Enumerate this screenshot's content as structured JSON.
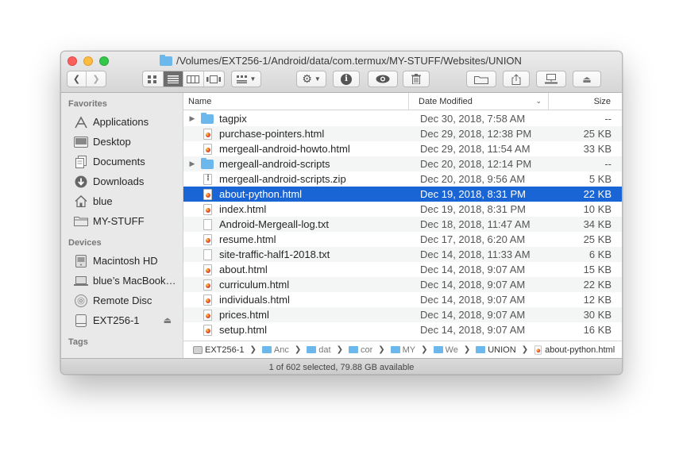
{
  "window": {
    "title": "/Volumes/EXT256-1/Android/data/com.termux/MY-STUFF/Websites/UNION"
  },
  "sidebar": {
    "sections": [
      {
        "label": "Favorites",
        "items": [
          {
            "label": "Applications",
            "icon": "applications-icon"
          },
          {
            "label": "Desktop",
            "icon": "desktop-icon"
          },
          {
            "label": "Documents",
            "icon": "documents-icon"
          },
          {
            "label": "Downloads",
            "icon": "downloads-icon"
          },
          {
            "label": "blue",
            "icon": "home-icon"
          },
          {
            "label": "MY-STUFF",
            "icon": "folder-icon"
          }
        ]
      },
      {
        "label": "Devices",
        "items": [
          {
            "label": "Macintosh HD",
            "icon": "hard-drive-icon"
          },
          {
            "label": "blue’s MacBook…",
            "icon": "laptop-icon"
          },
          {
            "label": "Remote Disc",
            "icon": "disc-icon"
          },
          {
            "label": "EXT256-1",
            "icon": "external-drive-icon",
            "eject": "⏏"
          }
        ]
      },
      {
        "label": "Tags",
        "items": []
      }
    ]
  },
  "columns": {
    "name": "Name",
    "date": "Date Modified",
    "size": "Size"
  },
  "files": [
    {
      "name": "tagpix",
      "date": "Dec 30, 2018, 7:58 AM",
      "size": "--",
      "kind": "folder"
    },
    {
      "name": "purchase-pointers.html",
      "date": "Dec 29, 2018, 12:38 PM",
      "size": "25 KB",
      "kind": "html"
    },
    {
      "name": "mergeall-android-howto.html",
      "date": "Dec 29, 2018, 11:54 AM",
      "size": "33 KB",
      "kind": "html"
    },
    {
      "name": "mergeall-android-scripts",
      "date": "Dec 20, 2018, 12:14 PM",
      "size": "--",
      "kind": "folder"
    },
    {
      "name": "mergeall-android-scripts.zip",
      "date": "Dec 20, 2018, 9:56 AM",
      "size": "5 KB",
      "kind": "zip"
    },
    {
      "name": "about-python.html",
      "date": "Dec 19, 2018, 8:31 PM",
      "size": "22 KB",
      "kind": "html",
      "selected": true
    },
    {
      "name": "index.html",
      "date": "Dec 19, 2018, 8:31 PM",
      "size": "10 KB",
      "kind": "html"
    },
    {
      "name": "Android-Mergeall-log.txt",
      "date": "Dec 18, 2018, 11:47 AM",
      "size": "34 KB",
      "kind": "txt"
    },
    {
      "name": "resume.html",
      "date": "Dec 17, 2018, 6:20 AM",
      "size": "25 KB",
      "kind": "html"
    },
    {
      "name": "site-traffic-half1-2018.txt",
      "date": "Dec 14, 2018, 11:33 AM",
      "size": "6 KB",
      "kind": "txt"
    },
    {
      "name": "about.html",
      "date": "Dec 14, 2018, 9:07 AM",
      "size": "15 KB",
      "kind": "html"
    },
    {
      "name": "curriculum.html",
      "date": "Dec 14, 2018, 9:07 AM",
      "size": "22 KB",
      "kind": "html"
    },
    {
      "name": "individuals.html",
      "date": "Dec 14, 2018, 9:07 AM",
      "size": "12 KB",
      "kind": "html"
    },
    {
      "name": "prices.html",
      "date": "Dec 14, 2018, 9:07 AM",
      "size": "30 KB",
      "kind": "html"
    },
    {
      "name": "setup.html",
      "date": "Dec 14, 2018, 9:07 AM",
      "size": "16 KB",
      "kind": "html"
    }
  ],
  "pathbar": [
    {
      "label": "EXT256-1",
      "kind": "drive"
    },
    {
      "label": "Anc",
      "kind": "folder",
      "truncated": true
    },
    {
      "label": "dat",
      "kind": "folder",
      "truncated": true
    },
    {
      "label": "cor",
      "kind": "folder",
      "truncated": true
    },
    {
      "label": "MY",
      "kind": "folder",
      "truncated": true
    },
    {
      "label": "We",
      "kind": "folder",
      "truncated": true
    },
    {
      "label": "UNION",
      "kind": "folder"
    },
    {
      "label": "about-python.html",
      "kind": "html"
    }
  ],
  "status": "1 of 602 selected, 79.88 GB available",
  "colors": {
    "selection": "#1a65d6",
    "folder": "#6cb8ec"
  }
}
